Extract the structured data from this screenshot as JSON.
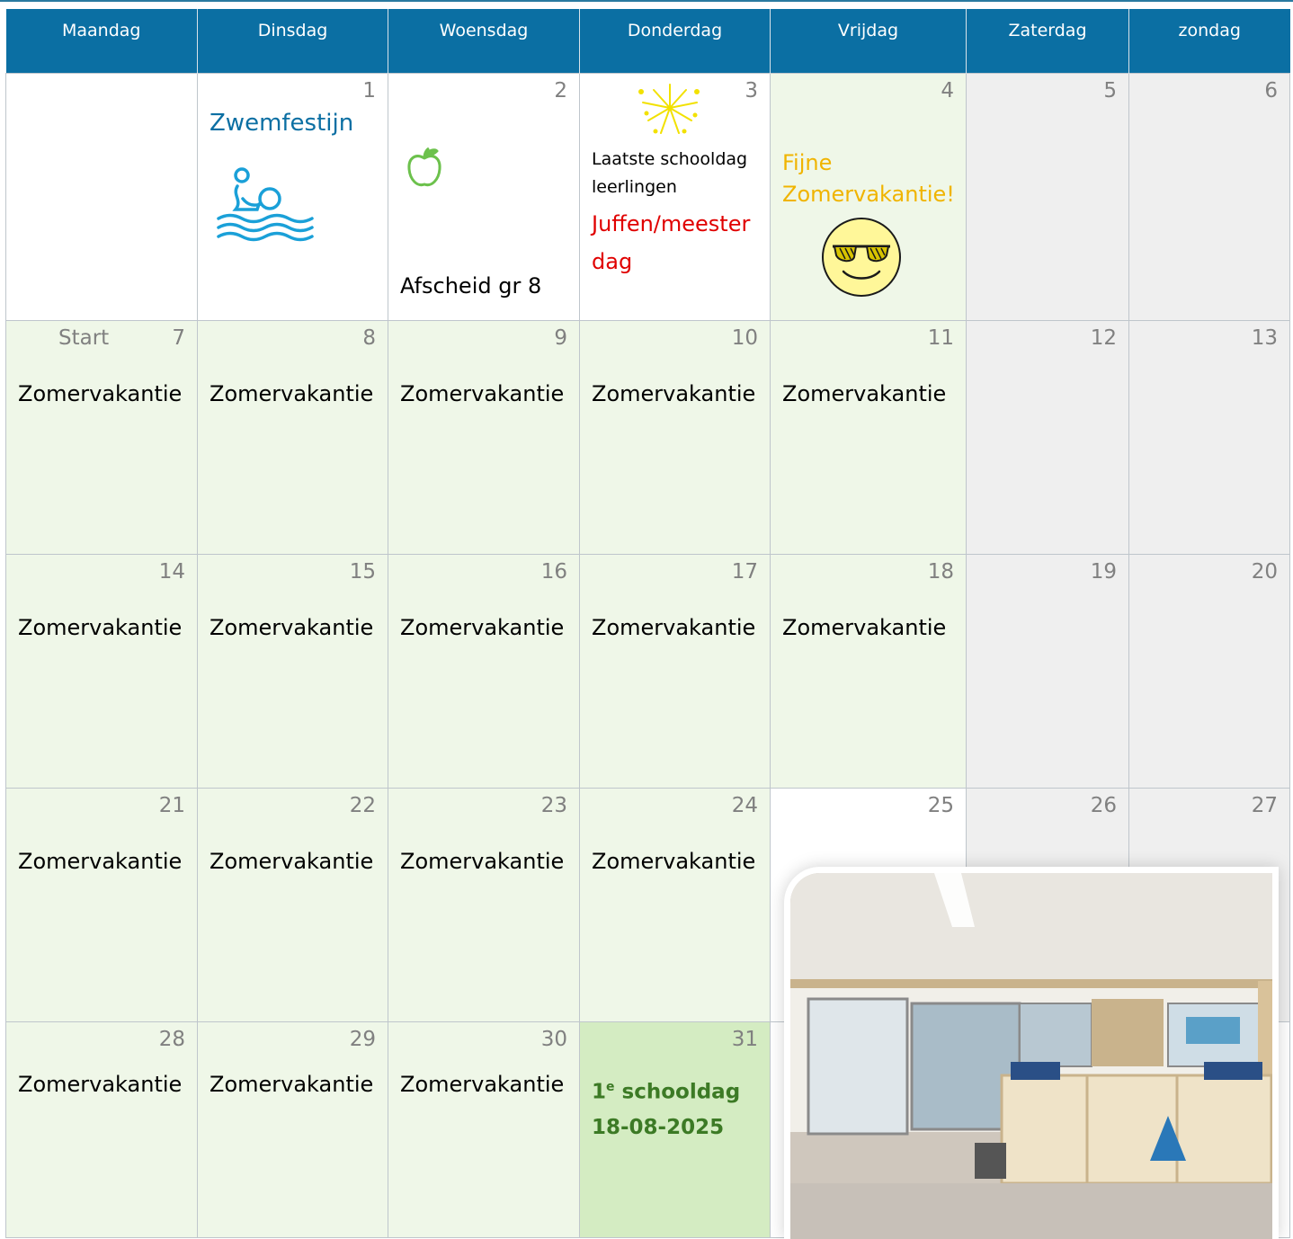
{
  "weekdays": [
    "Maandag",
    "Dinsdag",
    "Woensdag",
    "Donderdag",
    "Vrijdag",
    "Zaterdag",
    "zondag"
  ],
  "weeks": [
    [
      {
        "num": ""
      },
      {
        "num": "1",
        "event": "Zwemfestijn"
      },
      {
        "num": "2",
        "event": "Afscheid gr 8"
      },
      {
        "num": "3",
        "line1": "Laatste schooldag",
        "line2": "leerlingen",
        "line3": "Juffen/meester",
        "line4": "dag"
      },
      {
        "num": "4",
        "line1": "Fijne",
        "line2": "Zomervakantie!"
      },
      {
        "num": "5"
      },
      {
        "num": "6"
      }
    ],
    [
      {
        "num": "7",
        "prefix": "Start",
        "event": "Zomervakantie"
      },
      {
        "num": "8",
        "event": "Zomervakantie"
      },
      {
        "num": "9",
        "event": "Zomervakantie"
      },
      {
        "num": "10",
        "event": "Zomervakantie"
      },
      {
        "num": "11",
        "event": "Zomervakantie"
      },
      {
        "num": "12"
      },
      {
        "num": "13"
      }
    ],
    [
      {
        "num": "14",
        "event": "Zomervakantie"
      },
      {
        "num": "15",
        "event": "Zomervakantie"
      },
      {
        "num": "16",
        "event": "Zomervakantie"
      },
      {
        "num": "17",
        "event": "Zomervakantie"
      },
      {
        "num": "18",
        "event": "Zomervakantie"
      },
      {
        "num": "19"
      },
      {
        "num": "20"
      }
    ],
    [
      {
        "num": "21",
        "event": "Zomervakantie"
      },
      {
        "num": "22",
        "event": "Zomervakantie"
      },
      {
        "num": "23",
        "event": "Zomervakantie"
      },
      {
        "num": "24",
        "event": "Zomervakantie"
      },
      {
        "num": "25"
      },
      {
        "num": "26"
      },
      {
        "num": "27"
      }
    ],
    [
      {
        "num": "28",
        "event": "Zomervakantie"
      },
      {
        "num": "29",
        "event": "Zomervakantie"
      },
      {
        "num": "30",
        "event": "Zomervakantie"
      },
      {
        "num": "31",
        "first_num": "1",
        "first_sup": "e",
        "first_word": "schooldag",
        "first_date": "18-08-2025"
      }
    ]
  ],
  "icons": {
    "swimmer": "swimmer-icon",
    "apple": "apple-icon",
    "fireworks": "fireworks-icon",
    "sunglasses_smiley": "sunglasses-smiley-icon"
  },
  "colors": {
    "header": "#0b6fa3",
    "vacation": "#eff7e8",
    "weekend": "#efefef",
    "first_day": "#d4ecc2",
    "swim_text": "#0b6fa3",
    "juffen_text": "#e00000",
    "fijne_text": "#f0b400",
    "first_day_text": "#3c7a25"
  }
}
